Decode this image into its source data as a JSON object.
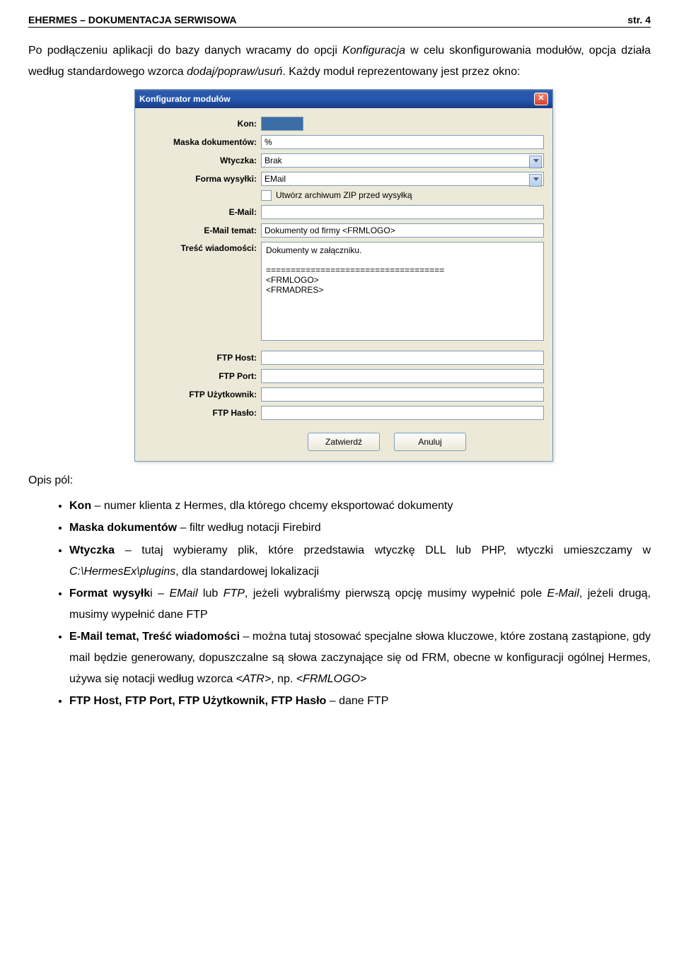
{
  "header": {
    "left": "EHERMES – DOKUMENTACJA SERWISOWA",
    "right": "str. 4"
  },
  "intro": {
    "p1a": "Po podłączeniu aplikacji do bazy danych wracamy do opcji ",
    "p1b": "Konfiguracja",
    "p1c": " w celu skonfigurowania modułów, opcja działa według standardowego wzorca ",
    "p1d": "dodaj/popraw/usuń",
    "p1e": ". Każdy moduł reprezentowany jest przez okno:"
  },
  "window": {
    "title": "Konfigurator modułów",
    "labels": {
      "kon": "Kon:",
      "maska": "Maska dokumentów:",
      "wtyczka": "Wtyczka:",
      "forma": "Forma wysyłki:",
      "zip": "Utwórz archiwum ZIP przed wysyłką",
      "email": "E-Mail:",
      "temat": "E-Mail temat:",
      "tresc": "Treść wiadomości:",
      "ftphost": "FTP Host:",
      "ftpport": "FTP Port:",
      "ftpuser": "FTP Użytkownik:",
      "ftppass": "FTP Hasło:"
    },
    "values": {
      "maska": "%",
      "wtyczka": "Brak",
      "forma": "EMail",
      "temat": "Dokumenty od firmy <FRMLOGO>",
      "tresc": "Dokumenty w załączniku.\n\n====================================\n<FRMLOGO>\n<FRMADRES>"
    },
    "buttons": {
      "ok": "Zatwierdź",
      "cancel": "Anuluj"
    }
  },
  "opis": {
    "heading": "Opis pól:",
    "items": {
      "i0a": "Kon",
      "i0b": " – numer klienta z Hermes, dla którego chcemy eksportować dokumenty",
      "i1a": "Maska dokumentów",
      "i1b": " – filtr według notacji Firebird",
      "i2a": "Wtyczka",
      "i2b": " – tutaj wybieramy plik, które przedstawia wtyczkę DLL lub PHP, wtyczki umieszczamy w ",
      "i2c": "C:\\HermesEx\\plugins",
      "i2d": ", dla standardowej lokalizacji",
      "i3a": "Format wysyłk",
      "i3b": "i – ",
      "i3c": "EMail",
      "i3d": " lub ",
      "i3e": "FTP",
      "i3f": ", jeżeli wybraliśmy pierwszą opcję musimy wypełnić pole ",
      "i3g": "E-Mail",
      "i3h": ", jeżeli drugą, musimy wypełnić dane FTP",
      "i4a": "E-Mail temat, Treść wiadomości",
      "i4b": " – można tutaj stosować specjalne słowa kluczowe, które zostaną zastąpione, gdy mail będzie generowany, dopuszczalne są słowa zaczynające się od FRM, obecne w konfiguracji ogólnej Hermes, używa się notacji według wzorca ",
      "i4c": "<ATR>",
      "i4d": ", np. ",
      "i4e": "<FRMLOGO>",
      "i5a": "FTP Host, FTP Port, FTP Użytkownik, FTP Hasło",
      "i5b": " – dane FTP"
    }
  }
}
